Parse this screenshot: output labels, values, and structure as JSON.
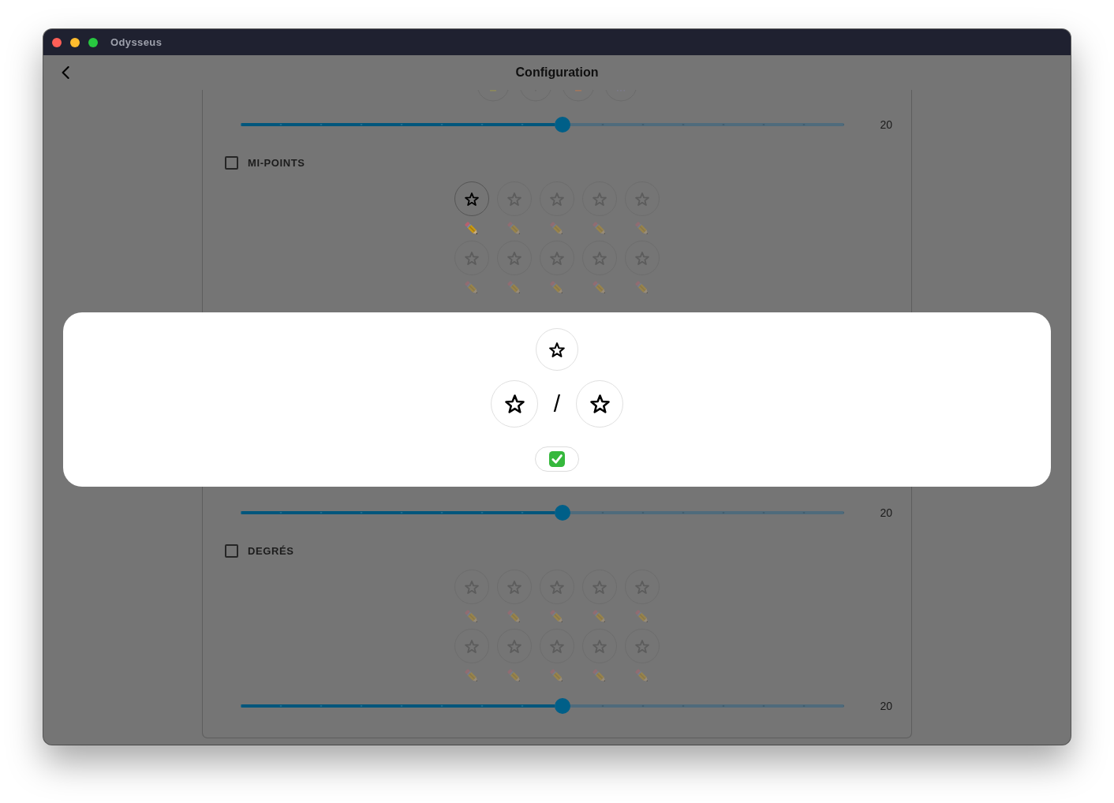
{
  "window": {
    "title": "Odysseus"
  },
  "header": {
    "title": "Configuration"
  },
  "content": [
    {
      "kind": "button_row"
    },
    {
      "kind": "slider",
      "level": 0.533,
      "reading": "20"
    },
    {
      "kind": "option",
      "label": "MI-POINTS",
      "checked": false,
      "rows": [
        {
          "cells": [
            {
              "selected": true
            },
            {
              "selected": false
            },
            {
              "selected": false
            },
            {
              "selected": false
            },
            {
              "selected": false
            }
          ]
        },
        {
          "cells": [
            {
              "selected": false
            },
            {
              "selected": false
            },
            {
              "selected": false
            },
            {
              "selected": false
            },
            {
              "selected": false
            }
          ]
        }
      ]
    },
    {
      "kind": "dialog",
      "separator": "/"
    },
    {
      "kind": "slider",
      "level": 0.533,
      "reading": "20"
    },
    {
      "kind": "option",
      "label": "DEGRÉS",
      "checked": false,
      "rows": [
        {
          "cells": [
            {
              "selected": false
            },
            {
              "selected": false
            },
            {
              "selected": false
            },
            {
              "selected": false
            },
            {
              "selected": false
            }
          ]
        },
        {
          "cells": [
            {
              "selected": false
            },
            {
              "selected": false
            },
            {
              "selected": false
            },
            {
              "selected": false
            },
            {
              "selected": false
            }
          ]
        }
      ]
    },
    {
      "kind": "slider",
      "level": 0.533,
      "reading": "20"
    }
  ]
}
